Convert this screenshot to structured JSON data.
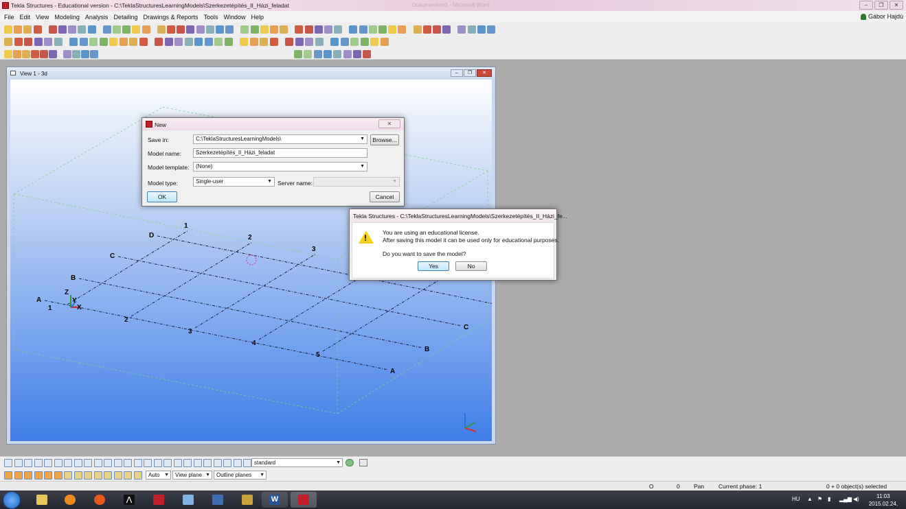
{
  "window": {
    "title": "Tekla Structures - Educational version - C:\\TeklaStructuresLearningModels\\Szerkezetépítés_II_Házi_feladat",
    "ghost_title": "Dokumentum1 - Microsoft Word",
    "buttons": [
      "–",
      "❐",
      "✕"
    ]
  },
  "menu": [
    "File",
    "Edit",
    "View",
    "Modeling",
    "Analysis",
    "Detailing",
    "Drawings & Reports",
    "Tools",
    "Window",
    "Help"
  ],
  "user": {
    "name": "Gábor Hajdú"
  },
  "view": {
    "title": "View 1 - 3d",
    "grid_rows": [
      "A",
      "B",
      "C",
      "D"
    ],
    "grid_cols": [
      "1",
      "2",
      "3",
      "4",
      "5"
    ],
    "axis_labels": {
      "z": "Z",
      "y": "Y",
      "x": "X"
    }
  },
  "new_dialog": {
    "title": "New",
    "close": "✕",
    "save_in_label": "Save in:",
    "save_in_value": "C:\\TeklaStructuresLearningModels\\",
    "browse": "Browse...",
    "model_name_label": "Model name:",
    "model_name_value": "Szerkezetépítés_II_Házi_feladat",
    "template_label": "Model template:",
    "template_value": "(None)",
    "type_label": "Model type:",
    "type_value": "Single-user",
    "server_label": "Server name:",
    "server_value": "",
    "ok": "OK",
    "cancel": "Cancel"
  },
  "confirm_dialog": {
    "title": "Tekla Structures - C:\\TeklaStructuresLearningModels\\Szerkezetépítés_II_Házi_fe...",
    "line1": "You are using an educational license.",
    "line2": "After saving this model it can be used only for educational purposes.",
    "question": "Do you want to save the model?",
    "yes": "Yes",
    "no": "No"
  },
  "bottom_toolbar": {
    "filter_value": "standard",
    "snap_mode": "Auto",
    "plane_mode": "View plane",
    "outline_mode": "Outline planes"
  },
  "status": {
    "o": "O",
    "zero": "0",
    "pan": "Pan",
    "phase": "Current phase: 1",
    "selected": "0 + 0 object(s) selected"
  },
  "taskbar": {
    "lang": "HU",
    "time": "11:03",
    "date": "2015.02.24."
  },
  "colors": {
    "grid_line": "#1b1b3a",
    "work_area": "#7fd18a",
    "dialog_title": "#f4e6ee",
    "accent_red": "#c0202a",
    "pick_point": "#c43bd8"
  }
}
